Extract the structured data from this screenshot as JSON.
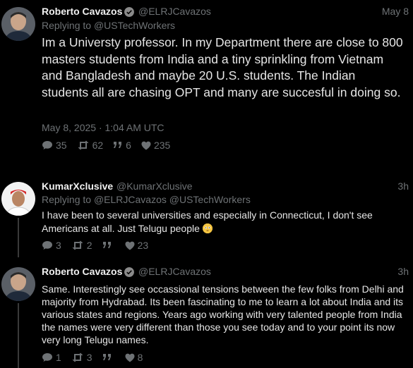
{
  "tweets": [
    {
      "author": "Roberto Cavazos",
      "handle": "@ELRJCavazos",
      "date": "May 8",
      "replying_prefix": "Replying to",
      "replying_to": "@USTechWorkers",
      "text": "Im a Universty professor.  In my Department there are close to 800 masters students from India and a tiny sprinkling from Vietnam and Bangladesh and maybe 20 U.S. students.  The Indian students all are chasing OPT and many are succesful in doing so.",
      "timestamp": "May 8, 2025 · 1:04 AM UTC",
      "replies": "35",
      "retweets": "62",
      "quotes": "6",
      "likes": "235"
    },
    {
      "author": "KumarXclusive",
      "handle": "@KumarXclusive",
      "date": "3h",
      "replying_prefix": "Replying to",
      "replying_to": "@ELRJCavazos @USTechWorkers",
      "text": "I have been to several universities and especially in Connecticut, I don't see Americans at all. Just Telugu people",
      "replies": "3",
      "retweets": "2",
      "quotes": "",
      "likes": "23"
    },
    {
      "author": "Roberto Cavazos",
      "handle": "@ELRJCavazos",
      "date": "3h",
      "text": "Same. Interestingly see occassional tensions between the few folks from Delhi and majority from Hydrabad.  Its been fascinating to me to learn a lot about India and its various states and regions. Years ago working with very talented people from India the names were very different than those you see today and to your point its now very long Telugu names.",
      "replies": "1",
      "retweets": "3",
      "quotes": "",
      "likes": "8"
    }
  ],
  "icons": {
    "reply": "comment-icon",
    "retweet": "retweet-icon",
    "quote": "quote-icon",
    "like": "heart-icon",
    "verified": "verified-badge-icon"
  }
}
